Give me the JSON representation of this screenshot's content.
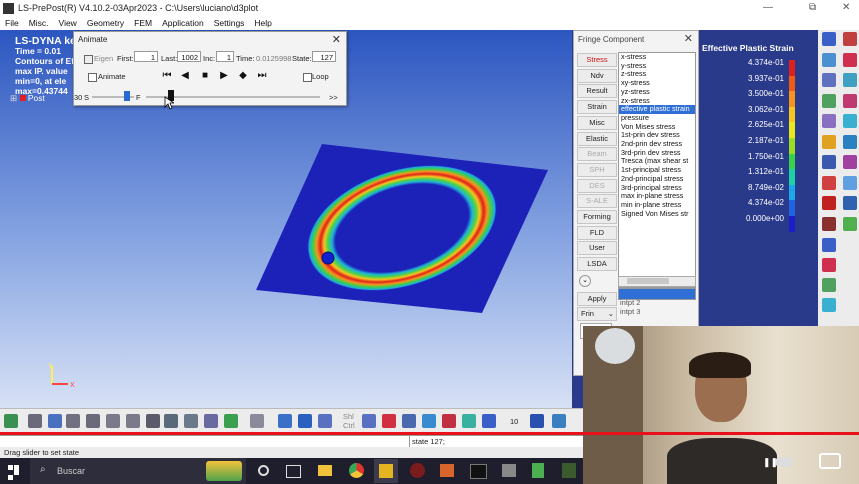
{
  "window": {
    "title": "LS-PrePost(R) V4.10.2-03Apr2023 - C:\\Users\\luciano\\d3plot",
    "min": "—",
    "max": "⧉",
    "close": "✕"
  },
  "menu": [
    "File",
    "Misc.",
    "View",
    "Geometry",
    "FEM",
    "Application",
    "Settings",
    "Help"
  ],
  "overlay": {
    "line1": "LS-DYNA ke",
    "line2": "Time =      0.01",
    "line3": "Contours of Ef",
    "line4": "max IP. value",
    "line5": "min=0, at ele",
    "line6": "max=0.43744",
    "post_label": "Post"
  },
  "animate": {
    "title": "Animate",
    "eigen": "Eigen",
    "first_label": "First:",
    "first": "1",
    "last_label": "Last:",
    "last": "1002",
    "inc_label": "Inc:",
    "inc": "1",
    "time_label": "Time:",
    "time": "0.0125998",
    "state_label": "State:",
    "state": "127",
    "animate_label": "Animate",
    "loop_label": "Loop",
    "speed": "30",
    "s_label": "S",
    "f_label": "F",
    "more": ">>",
    "slider_fraction": 0.127
  },
  "fringe": {
    "title": "Fringe Component",
    "buttons": [
      "Stress",
      "Ndv",
      "Result",
      "Strain",
      "Misc",
      "Elastic",
      "Beam",
      "SPH",
      "DES",
      "S-ALE",
      "Forming",
      "FLD",
      "User",
      "LSDA"
    ],
    "apply": "Apply",
    "frin": "Frin",
    "components": [
      "x-stress",
      "y-stress",
      "z-stress",
      "xy-stress",
      "yz-stress",
      "zx-stress",
      "effective plastic strain",
      "pressure",
      "Von Mises stress",
      "1st-prin dev stress",
      "2nd-prin dev stress",
      "3rd-prin dev stress",
      "Tresca (max shear st",
      "1st-principal stress",
      "2nd-principal stress",
      "3rd-principal stress",
      "max in-plane stress",
      "min in-plane stress",
      "Signed Von Mises str"
    ],
    "selected_index": 6,
    "intpt": [
      "intpt   2",
      "intpt   3"
    ]
  },
  "legend": {
    "title": "Effective Plastic Strain",
    "values": [
      "4.374e-01",
      "3.937e-01",
      "3.500e-01",
      "3.062e-01",
      "2.625e-01",
      "2.187e-01",
      "1.750e-01",
      "1.312e-01",
      "8.749e-02",
      "4.374e-02",
      "0.000e+00"
    ],
    "colors": [
      "#e0201c",
      "#f05a14",
      "#f7941d",
      "#f7c51d",
      "#e8e81a",
      "#9bdc1e",
      "#37d24a",
      "#1ed2a8",
      "#1aa8e8",
      "#1f63e0",
      "#1e1ec8"
    ]
  },
  "axes": {
    "y": "Y",
    "x": "X"
  },
  "bottom": {
    "shl": "Shl",
    "ctrl": "Ctrl",
    "num": "10",
    "cmd": "state 127;",
    "status": "Drag slider to set state"
  },
  "taskbar": {
    "search": "Buscar"
  }
}
